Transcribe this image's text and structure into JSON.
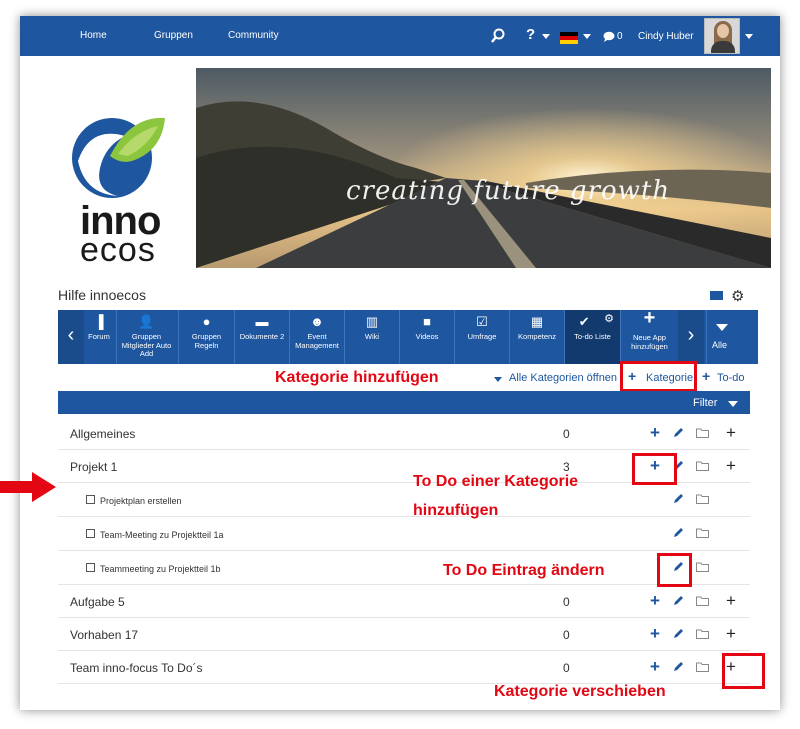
{
  "nav": {
    "links": [
      "Home",
      "Gruppen",
      "Community"
    ],
    "chat_count": "0",
    "user_name": "Cindy Huber",
    "help_label": "?"
  },
  "logo": {
    "line1": "inno",
    "line2": "ecos"
  },
  "banner": {
    "tagline": "creating future growth"
  },
  "page": {
    "title": "Hilfe innoecos"
  },
  "apps": [
    {
      "icon": "forum-icon",
      "label": "Forum"
    },
    {
      "icon": "group-members-icon",
      "label": "Gruppen Mitglieder Auto Add"
    },
    {
      "icon": "group-rules-icon",
      "label": "Gruppen Regeln"
    },
    {
      "icon": "documents-icon",
      "label": "Dokumente 2"
    },
    {
      "icon": "event-icon",
      "label": "Event Management"
    },
    {
      "icon": "wiki-icon",
      "label": "Wiki"
    },
    {
      "icon": "videos-icon",
      "label": "Videos"
    },
    {
      "icon": "survey-icon",
      "label": "Umfrage"
    },
    {
      "icon": "competence-icon",
      "label": "Kompetenz"
    },
    {
      "icon": "todo-icon",
      "label": "To-do Liste"
    },
    {
      "icon": "add-app-icon",
      "label": "Neue App hinzufügen"
    }
  ],
  "apps_all_label": "Alle",
  "toolbar": {
    "open_all": "Alle Kategorien öffnen",
    "add_category": "Kategorie",
    "add_todo": "To-do"
  },
  "filter_label": "Filter",
  "categories": [
    {
      "name": "Allgemeines",
      "count": "0"
    },
    {
      "name": "Projekt 1",
      "count": "3"
    },
    {
      "name": "Aufgabe 5",
      "count": "0"
    },
    {
      "name": "Vorhaben 17",
      "count": "0"
    },
    {
      "name": "Team inno-focus To Do´s",
      "count": "0"
    }
  ],
  "items": [
    {
      "name": "Projektplan erstellen"
    },
    {
      "name": "Team-Meeting zu Projektteil 1a"
    },
    {
      "name": "Teammeeting zu Projektteil 1b"
    }
  ],
  "callouts": {
    "add_category": "Kategorie hinzufügen",
    "add_todo_line1": "To Do einer Kategorie",
    "add_todo_line2": "hinzufügen",
    "edit_todo": "To Do Eintrag ändern",
    "move_category": "Kategorie verschieben"
  },
  "colors": {
    "primary": "#1e56a0",
    "callout": "#e30613"
  }
}
